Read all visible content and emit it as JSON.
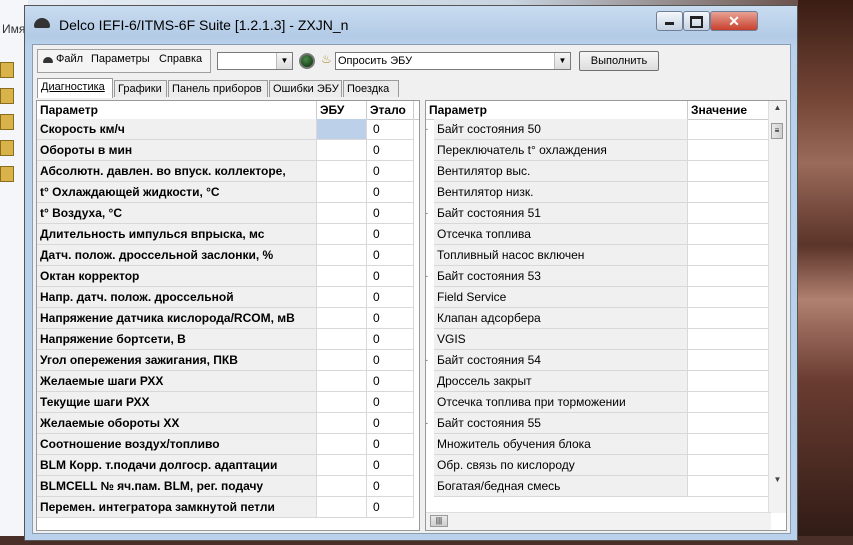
{
  "desktop": {
    "left_label": "Имя"
  },
  "window": {
    "title": "Delco IEFI-6/ITMS-6F Suite [1.2.1.3] - ZXJN_n",
    "close_glyph": "✕"
  },
  "menu": {
    "items": [
      "Файл",
      "Параметры",
      "Справка"
    ]
  },
  "toolbar": {
    "port_value": "",
    "request_combo_value": "Опросить ЭБУ",
    "run_button_label": "Выполнить"
  },
  "tabs": [
    {
      "label": "Диагностика",
      "active": true
    },
    {
      "label": "Графики",
      "active": false
    },
    {
      "label": "Панель приборов",
      "active": false
    },
    {
      "label": "Ошибки ЭБУ",
      "active": false
    },
    {
      "label": "Поездка",
      "active": false
    }
  ],
  "left_table": {
    "headers": {
      "param": "Параметр",
      "ecu": "ЭБУ",
      "ref": "Этало"
    },
    "rows": [
      {
        "name": "Скорость км/ч",
        "ecu": "",
        "ref": "0"
      },
      {
        "name": "Обороты в мин",
        "ecu": "",
        "ref": "0"
      },
      {
        "name": "Абсолютн. давлен. во впуск. коллекторе,",
        "ecu": "",
        "ref": "0"
      },
      {
        "name": "t° Охлаждающей жидкости, °C",
        "ecu": "",
        "ref": "0"
      },
      {
        "name": "t° Воздуха, °C",
        "ecu": "",
        "ref": "0"
      },
      {
        "name": "Длительность импулься впрыска, мс",
        "ecu": "",
        "ref": "0"
      },
      {
        "name": "Датч. полож. дроссельной заслонки, %",
        "ecu": "",
        "ref": "0"
      },
      {
        "name": "Октан корректор",
        "ecu": "",
        "ref": "0"
      },
      {
        "name": "Напр. датч. полож. дроссельной",
        "ecu": "",
        "ref": "0"
      },
      {
        "name": "Напряжение датчика кислорода/RCOM, мВ",
        "ecu": "",
        "ref": "0"
      },
      {
        "name": "Напряжение бортсети, В",
        "ecu": "",
        "ref": "0"
      },
      {
        "name": "Угол опережения зажигания, ПКВ",
        "ecu": "",
        "ref": "0"
      },
      {
        "name": "Желаемые шаги РХХ",
        "ecu": "",
        "ref": "0"
      },
      {
        "name": "Текущие шаги РХХ",
        "ecu": "",
        "ref": "0"
      },
      {
        "name": "Желаемые обороты ХХ",
        "ecu": "",
        "ref": "0"
      },
      {
        "name": "Соотношение воздух/топливо",
        "ecu": "",
        "ref": "0"
      },
      {
        "name": "BLM Корр. т.подачи долгоср. адаптации",
        "ecu": "",
        "ref": "0"
      },
      {
        "name": "BLMCELL № яч.пам. BLM, рег. подачу",
        "ecu": "",
        "ref": "0"
      },
      {
        "name": "Перемен. интегратора замкнутой петли",
        "ecu": "",
        "ref": "0"
      }
    ]
  },
  "right_table": {
    "headers": {
      "param": "Параметр",
      "value": "Значение"
    },
    "rows": [
      {
        "name": "Байт состояния 50",
        "value": "",
        "group": true
      },
      {
        "name": "Переключатель t° охлаждения",
        "value": "",
        "group": false
      },
      {
        "name": "Вентилятор выс.",
        "value": "",
        "group": false
      },
      {
        "name": "Вентилятор низк.",
        "value": "",
        "group": false
      },
      {
        "name": "Байт состояния 51",
        "value": "",
        "group": true
      },
      {
        "name": "Отсечка топлива",
        "value": "",
        "group": false
      },
      {
        "name": "Топливный насос включен",
        "value": "",
        "group": false
      },
      {
        "name": "Байт состояния 53",
        "value": "",
        "group": true
      },
      {
        "name": "Field Service",
        "value": "",
        "group": false
      },
      {
        "name": "Клапан адсорбера",
        "value": "",
        "group": false
      },
      {
        "name": "VGIS",
        "value": "",
        "group": false
      },
      {
        "name": "Байт состояния 54",
        "value": "",
        "group": true
      },
      {
        "name": "Дроссель закрыт",
        "value": "",
        "group": false
      },
      {
        "name": "Отсечка топлива при торможении",
        "value": "",
        "group": false
      },
      {
        "name": "Байт состояния 55",
        "value": "",
        "group": true
      },
      {
        "name": "Множитель обучения блока",
        "value": "",
        "group": false
      },
      {
        "name": "Обр. связь по кислороду",
        "value": "",
        "group": false
      },
      {
        "name": "Богатая/бедная смесь",
        "value": "",
        "group": false
      }
    ]
  }
}
